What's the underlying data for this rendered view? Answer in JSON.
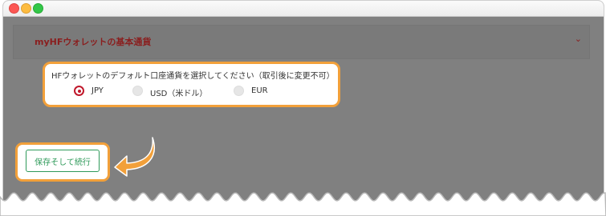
{
  "panel": {
    "title": "myHFウォレットの基本通貨",
    "toggle_icon": "chevron-down-icon"
  },
  "currency": {
    "prompt": "HFウォレットのデフォルト口座通貨を選択してください（取引後に変更不可）",
    "options": [
      {
        "label": "JPY",
        "selected": true
      },
      {
        "label": "USD（米ドル）",
        "selected": false
      },
      {
        "label": "EUR",
        "selected": false
      }
    ]
  },
  "save_button_label": "保存そして続行",
  "colors": {
    "highlight": "#f2a03a",
    "brand_red": "#c0182b",
    "button_green": "#2f9a5a",
    "overlay": "#808080"
  }
}
